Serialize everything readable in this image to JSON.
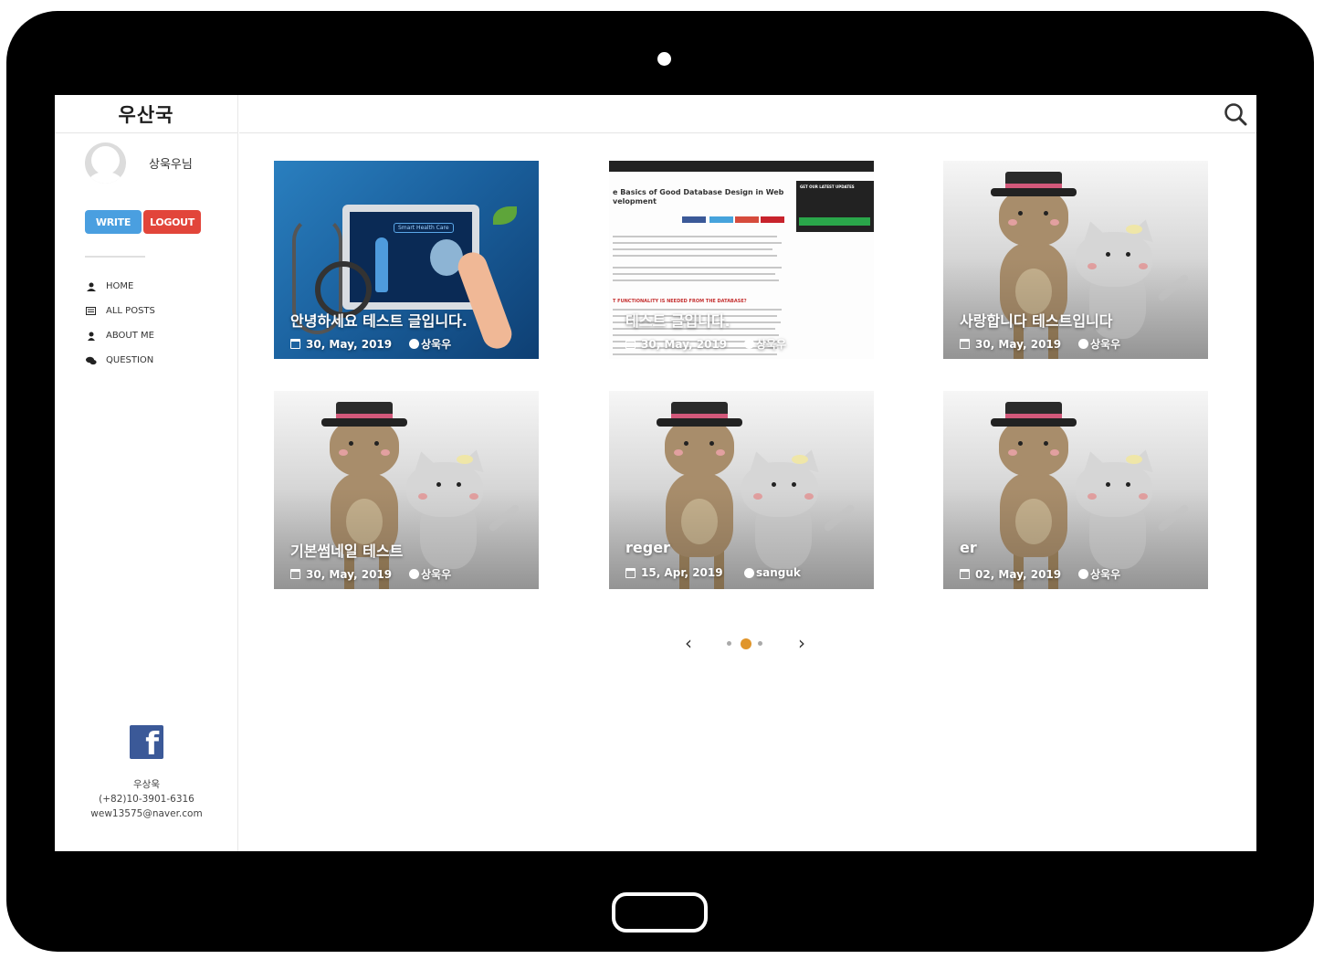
{
  "app": {
    "logo": "우산국"
  },
  "profile": {
    "name": "상욱우님"
  },
  "buttons": {
    "write": "WRITE",
    "logout": "LOGOUT"
  },
  "nav": [
    {
      "label": "HOME",
      "icon": "user-icon"
    },
    {
      "label": "ALL POSTS",
      "icon": "list-icon"
    },
    {
      "label": "ABOUT ME",
      "icon": "person-icon"
    },
    {
      "label": "QUESTION",
      "icon": "chat-icon"
    }
  ],
  "footer": {
    "name": "우상욱",
    "phone": "(+82)10-3901-6316",
    "email": "wew13575@naver.com",
    "fb_letter": "f"
  },
  "posts": [
    {
      "title": "안녕하세요 테스트 글입니다.",
      "date": "30, May, 2019",
      "author": "상욱우",
      "image": "medical"
    },
    {
      "title": "테스트 글입니다.",
      "date": "30, May, 2019",
      "author": "상욱우",
      "image": "database-screenshot"
    },
    {
      "title": "사랑합니다 테스트입니다",
      "date": "30, May, 2019",
      "author": "상욱우",
      "image": "cats"
    },
    {
      "title": "기본썸네일 테스트",
      "date": "30, May, 2019",
      "author": "상욱우",
      "image": "cats"
    },
    {
      "title": "reger",
      "date": "15, Apr, 2019",
      "author": "sanguk",
      "image": "cats"
    },
    {
      "title": "er",
      "date": "02, May, 2019",
      "author": "상욱우",
      "image": "cats"
    }
  ],
  "screenshot": {
    "title": "e Basics of Good Database Design in Web\nvelopment",
    "subsection": "T FUNCTIONALITY IS NEEDED FROM THE DATABASE?",
    "sidebar_heading": "GET OUR LATEST UPDATES",
    "medical_label": "Smart Health Care"
  },
  "pagination": {
    "pages": 3,
    "current": 2,
    "prev": "‹",
    "next": "›"
  },
  "colors": {
    "write": "#4a9fe0",
    "logout": "#e2453a",
    "active_dot": "#e0952a",
    "facebook": "#3b5998"
  }
}
